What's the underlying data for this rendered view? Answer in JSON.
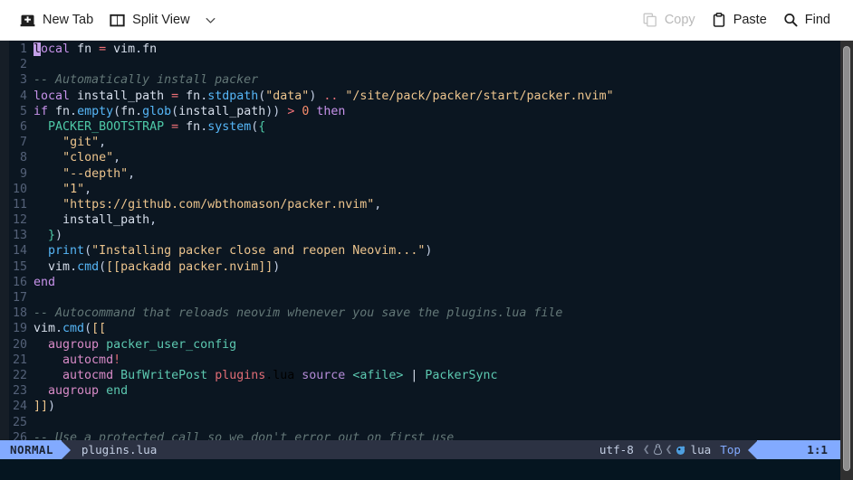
{
  "toolbar": {
    "left_buttons": [
      {
        "label": "New Tab",
        "icon": "new-tab-icon",
        "disabled": false
      },
      {
        "label": "Split View",
        "icon": "split-view-icon",
        "disabled": false
      }
    ],
    "dropdown_icon": "chevron-down-icon",
    "right_buttons": [
      {
        "label": "Copy",
        "icon": "copy-icon",
        "disabled": true
      },
      {
        "label": "Paste",
        "icon": "paste-icon",
        "disabled": false
      },
      {
        "label": "Find",
        "icon": "search-icon",
        "disabled": false
      }
    ]
  },
  "editor": {
    "cursor_char": "l",
    "lines": [
      {
        "n": "1",
        "text": "local fn = vim.fn"
      },
      {
        "n": "2",
        "text": ""
      },
      {
        "n": "3",
        "text": "-- Automatically install packer"
      },
      {
        "n": "4",
        "text": "local install_path = fn.stdpath(\"data\") .. \"/site/pack/packer/start/packer.nvim\""
      },
      {
        "n": "5",
        "text": "if fn.empty(fn.glob(install_path)) > 0 then"
      },
      {
        "n": "6",
        "text": "  PACKER_BOOTSTRAP = fn.system({"
      },
      {
        "n": "7",
        "text": "    \"git\","
      },
      {
        "n": "8",
        "text": "    \"clone\","
      },
      {
        "n": "9",
        "text": "    \"--depth\","
      },
      {
        "n": "10",
        "text": "    \"1\","
      },
      {
        "n": "11",
        "text": "    \"https://github.com/wbthomason/packer.nvim\","
      },
      {
        "n": "12",
        "text": "    install_path,"
      },
      {
        "n": "13",
        "text": "  })"
      },
      {
        "n": "14",
        "text": "  print(\"Installing packer close and reopen Neovim...\")"
      },
      {
        "n": "15",
        "text": "  vim.cmd([[packadd packer.nvim]])"
      },
      {
        "n": "16",
        "text": "end"
      },
      {
        "n": "17",
        "text": ""
      },
      {
        "n": "18",
        "text": "-- Autocommand that reloads neovim whenever you save the plugins.lua file"
      },
      {
        "n": "19",
        "text": "vim.cmd([["
      },
      {
        "n": "20",
        "text": "  augroup packer_user_config"
      },
      {
        "n": "21",
        "text": "    autocmd!"
      },
      {
        "n": "22",
        "text": "    autocmd BufWritePost plugins.lua source <afile> | PackerSync"
      },
      {
        "n": "23",
        "text": "  augroup end"
      },
      {
        "n": "24",
        "text": "]])"
      },
      {
        "n": "25",
        "text": ""
      },
      {
        "n": "26",
        "text": "-- Use a protected call so we don't error out on first use"
      }
    ]
  },
  "statusline": {
    "mode": "NORMAL",
    "filename": "plugins.lua",
    "encoding": "utf-8",
    "separator": "❮",
    "os_icon": "linux-tux-icon",
    "lang_icon": "lua-moon-icon",
    "language": "lua",
    "scroll_position": "Top",
    "cursor_position": "1:1"
  },
  "colors": {
    "toolbar_bg": "#ffffff",
    "editor_bg": "#0b1621",
    "statusline_bg": "#2c3243",
    "accent_blue": "#82aaff",
    "scrollbar_track": "#303030",
    "scrollbar_thumb": "#8d8d8d"
  }
}
